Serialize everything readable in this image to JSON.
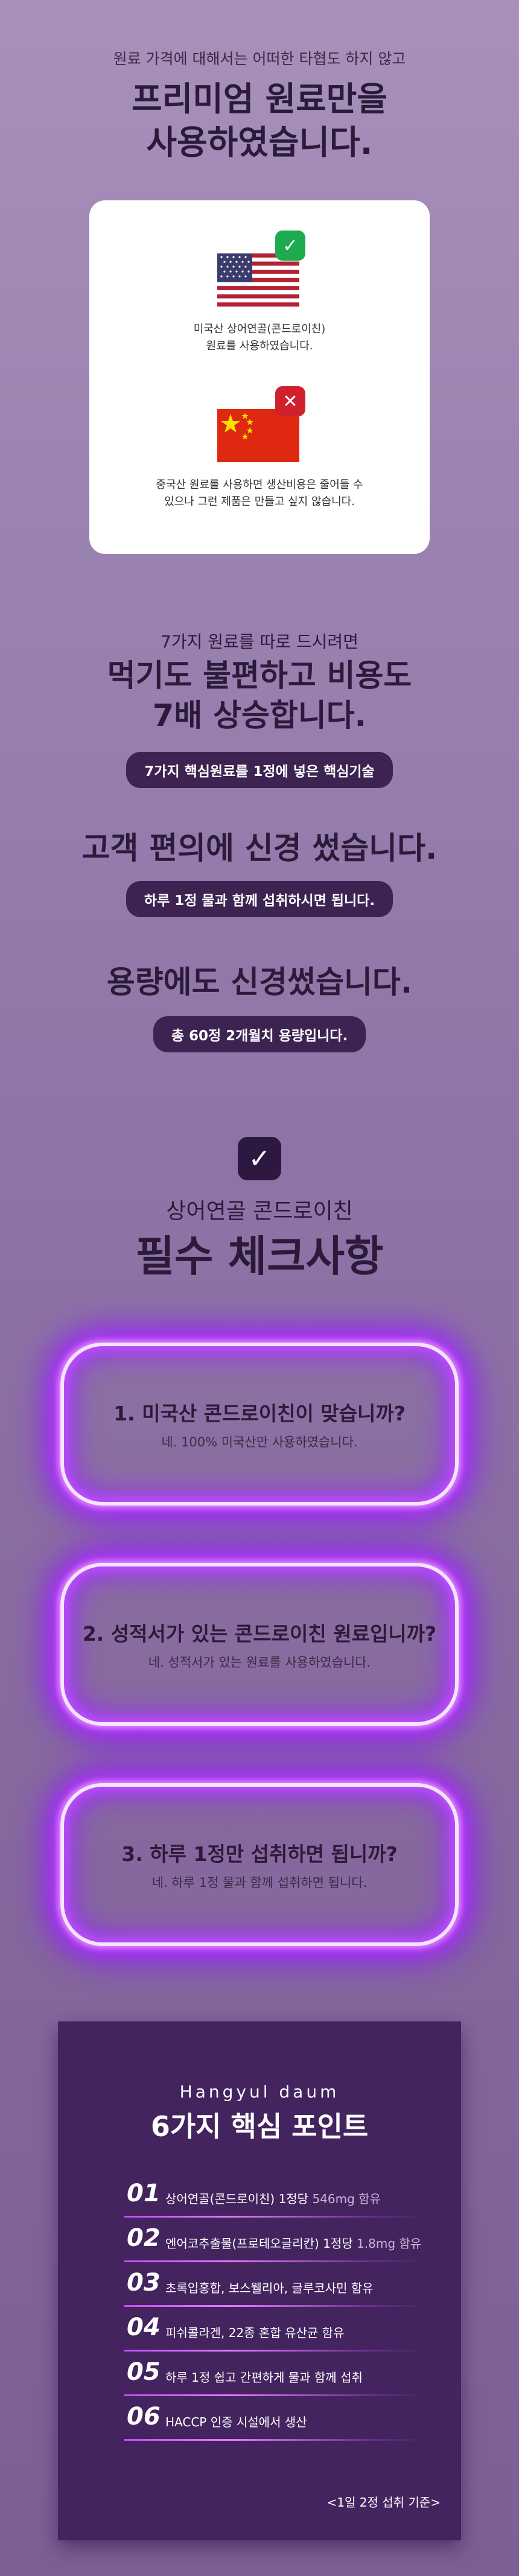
{
  "intro": {
    "line1": "원료 가격에 대해서는 어떠한 타협도 하지 않고",
    "heading_1": "프리미엄 원료만을",
    "heading_2": "사용하였습니다."
  },
  "compare_card": {
    "us_text_1": "미국산 상어연골(콘드로이친)",
    "us_text_2": "원료를 사용하였습니다.",
    "cn_text_1": "중국산 원료를 사용하면 생산비용은 줄어들 수",
    "cn_text_2": "있으나 그런 제품은 만들고 싶지 않습니다."
  },
  "section2": {
    "sub": "7가지 원료를 따로 드시려면",
    "heading_1": "먹기도 불편하고 비용도",
    "heading_2": "7배 상승합니다.",
    "pill": "7가지 핵심원료를 1정에 넣은 핵심기술"
  },
  "section3": {
    "heading": "고객 편의에 신경 썼습니다.",
    "pill": "하루 1정 물과 함께 섭취하시면 됩니다."
  },
  "section4": {
    "heading": "용량에도 신경썼습니다.",
    "pill": "총 60정 2개월치 용량입니다."
  },
  "checklist": {
    "sub": "상어연골 콘드로이친",
    "heading": "필수 체크사항",
    "items": [
      {
        "q": "1. 미국산 콘드로이친이 맞습니까?",
        "a": "네. 100% 미국산만 사용하였습니다."
      },
      {
        "q": "2. 성적서가 있는 콘드로이친 원료입니까?",
        "a": "네. 성적서가 있는 원료를 사용하였습니다."
      },
      {
        "q": "3. 하루 1정만 섭취하면 됩니까?",
        "a": "네. 하루 1정 물과 함께 섭취하면 됩니다."
      }
    ]
  },
  "points": {
    "brand": "Hangyul daum",
    "title": "6가지 핵심 포인트",
    "items": [
      {
        "num": "01",
        "text": "상어연골(콘드로이친) 1정당",
        "dim": " 546mg 함유"
      },
      {
        "num": "02",
        "text": "엔어코추출물(프로테오글리칸) 1정당",
        "dim": " 1.8mg 함유"
      },
      {
        "num": "03",
        "text": "초록입홍합, 보스웰리아, 글루코사민 함유",
        "dim": ""
      },
      {
        "num": "04",
        "text": "피쉬콜라겐, 22종 혼합 유산균 함유",
        "dim": ""
      },
      {
        "num": "05",
        "text": "하루 1정 쉽고 간편하게 물과 함께 섭취",
        "dim": ""
      },
      {
        "num": "06",
        "text": "HACCP 인증 시설에서 생산",
        "dim": ""
      }
    ],
    "footnote": "<1일 2정 섭취 기준>"
  },
  "colors": {
    "background": "#9b83b1",
    "pill": "#3d2352",
    "neon": "#bb39ff",
    "points_bg": "#43245e"
  }
}
